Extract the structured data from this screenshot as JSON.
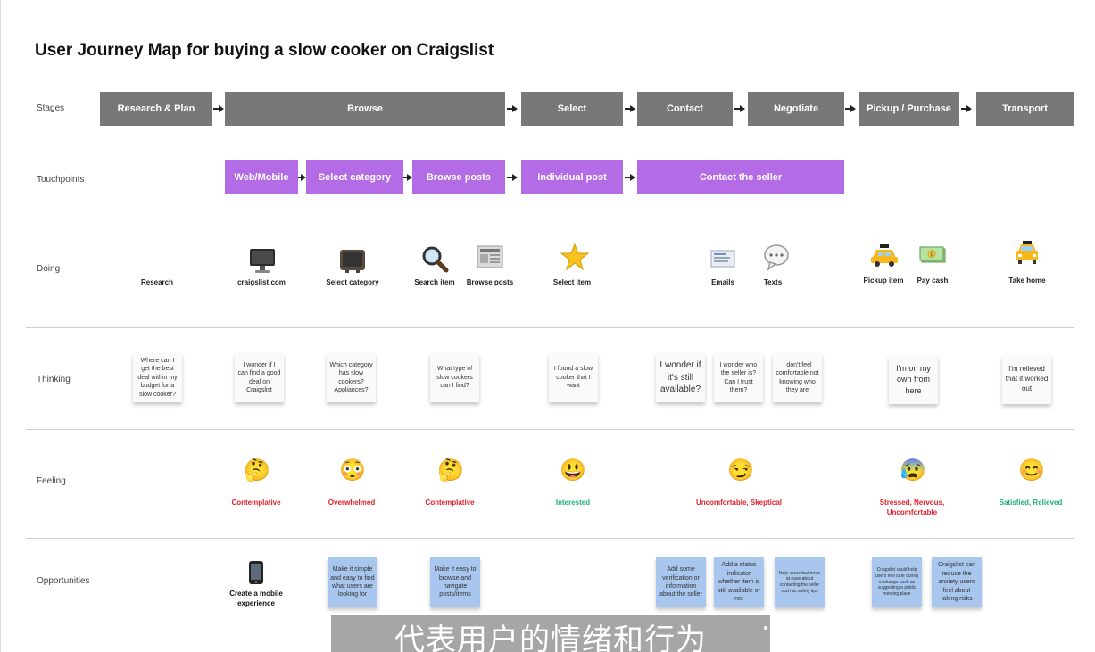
{
  "title": "User Journey Map for buying a slow cooker on Craigslist",
  "row_labels": {
    "stages": "Stages",
    "touchpoints": "Touchpoints",
    "doing": "Doing",
    "thinking": "Thinking",
    "feeling": "Feeling",
    "opportunities": "Opportunities"
  },
  "stages": [
    "Research & Plan",
    "Browse",
    "Select",
    "Contact",
    "Negotiate",
    "Pickup / Purchase",
    "Transport"
  ],
  "touchpoints": [
    "Web/Mobile",
    "Select category",
    "Browse posts",
    "Individual post",
    "Contact the seller"
  ],
  "doing": [
    {
      "label": "Research",
      "icon": ""
    },
    {
      "label": "craigslist.com",
      "icon": "computer-monitor-icon"
    },
    {
      "label": "Select category",
      "icon": "television-icon"
    },
    {
      "label": "Search item",
      "icon": "magnifying-glass-icon"
    },
    {
      "label": "Browse posts",
      "icon": "newspaper-icon"
    },
    {
      "label": "Select item",
      "icon": "star-icon"
    },
    {
      "label": "Emails",
      "icon": "email-icon"
    },
    {
      "label": "Texts",
      "icon": "speech-bubble-icon"
    },
    {
      "label": "Pickup item",
      "icon": "taxi-icon"
    },
    {
      "label": "Pay cash",
      "icon": "cash-icon"
    },
    {
      "label": "Take home",
      "icon": "oncoming-taxi-icon"
    }
  ],
  "thinking": [
    "Where can I get the best deal within my budget for a slow cooker?",
    "I wonder if I can find a good deal on Craigslist",
    "Which category has slow cookers? Appliances?",
    "What type of slow cookers can I find?",
    "I found a slow cooker that I want",
    "I wonder if it's still available?",
    "I wonder who the seller is? Can I trust them?",
    "I don't feel comfortable not knowing who they are",
    "I'm on my own from here",
    "I'm relieved that it worked out"
  ],
  "feelings": [
    {
      "label": "Contemplative",
      "emoji": "thinking-face-icon",
      "color": "#e0202a"
    },
    {
      "label": "Overwhelmed",
      "emoji": "flushed-face-icon",
      "color": "#e0202a"
    },
    {
      "label": "Contemplative",
      "emoji": "thinking-face-icon",
      "color": "#e0202a"
    },
    {
      "label": "Interested",
      "emoji": "grinning-face-icon",
      "color": "#22b07a"
    },
    {
      "label": "Uncomfortable, Skeptical",
      "emoji": "smirking-face-icon",
      "color": "#e0202a"
    },
    {
      "label": "Stressed, Nervous, Uncomfortable",
      "emoji": "anxious-face-icon",
      "color": "#e0202a"
    },
    {
      "label": "Satisfied, Relieved",
      "emoji": "smiling-face-icon",
      "color": "#22b07a"
    }
  ],
  "opportunities": {
    "mobile_label": "Create a mobile experience",
    "notes": [
      "Make it simple and easy to find what users are looking for",
      "Make it easy to browse and navigate posts/items",
      "Add some verification or information about the seller",
      "Add a status indicator whether item is still available or not",
      "Help users feel more at ease about contacting the seller such as safety tips",
      "Craigslist could help users feel safe during exchange such as suggesting a public meeting place",
      "Craigslist can reduce the anxiety users feel about taking risks"
    ]
  },
  "subtitle": "代表用户的情绪和行为",
  "colors": {
    "stage": "#787878",
    "touchpoint": "#b36ce6",
    "opportunity_note": "#a9c7ee",
    "negative_feeling": "#e0202a",
    "positive_feeling": "#22b07a"
  }
}
